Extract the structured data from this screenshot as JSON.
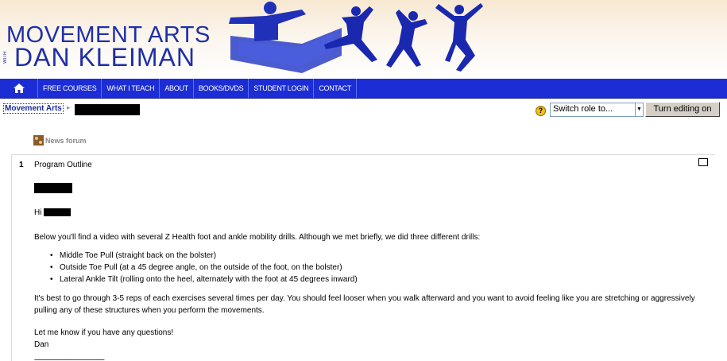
{
  "header": {
    "logo_line1": "MOVEMENT ARTS",
    "logo_with": "WITH",
    "logo_line2": "DAN KLEIMAN"
  },
  "nav": {
    "home_icon": "home-icon",
    "items": [
      {
        "label": "FREE COURSES"
      },
      {
        "label": "WHAT I TEACH"
      },
      {
        "label": "ABOUT"
      },
      {
        "label": "BOOKS/DVDS"
      },
      {
        "label": "STUDENT LOGIN"
      },
      {
        "label": "CONTACT"
      }
    ]
  },
  "breadcrumb": {
    "home": "Movement Arts",
    "separator": "▸"
  },
  "controls": {
    "help_icon": "help-icon",
    "role_select_value": "Switch role to...",
    "edit_button": "Turn editing on"
  },
  "forum": {
    "label": "News forum",
    "icon": "forum-icon"
  },
  "section": {
    "number": "1",
    "title": "Program Outline",
    "greeting": "Hi",
    "intro": "Below you'll find a video with several Z Health foot and ankle mobility drills. Although we met briefly, we did three different drills:",
    "bullets": [
      "Middle Toe Pull (straight back on the bolster)",
      "Outside Toe Pull (at a 45 degree angle, on the outside of the foot, on the bolster)",
      "Lateral Ankle Tilt (rolling onto the heel, alternately with the foot at 45 degrees inward)"
    ],
    "advice": "It's best to go through 3-5 reps of each exercises several times per day. You should feel looser when you walk afterward and you want to avoid feeling like you are stretching or aggressively pulling any of these structures when you perform the movements.",
    "closing": "Let me know if you have any questions!",
    "signature": "Dan",
    "rule": "--------------------------------------------"
  },
  "colors": {
    "nav_bg": "#1c2dd6",
    "brand_blue": "#1f2fa8"
  }
}
